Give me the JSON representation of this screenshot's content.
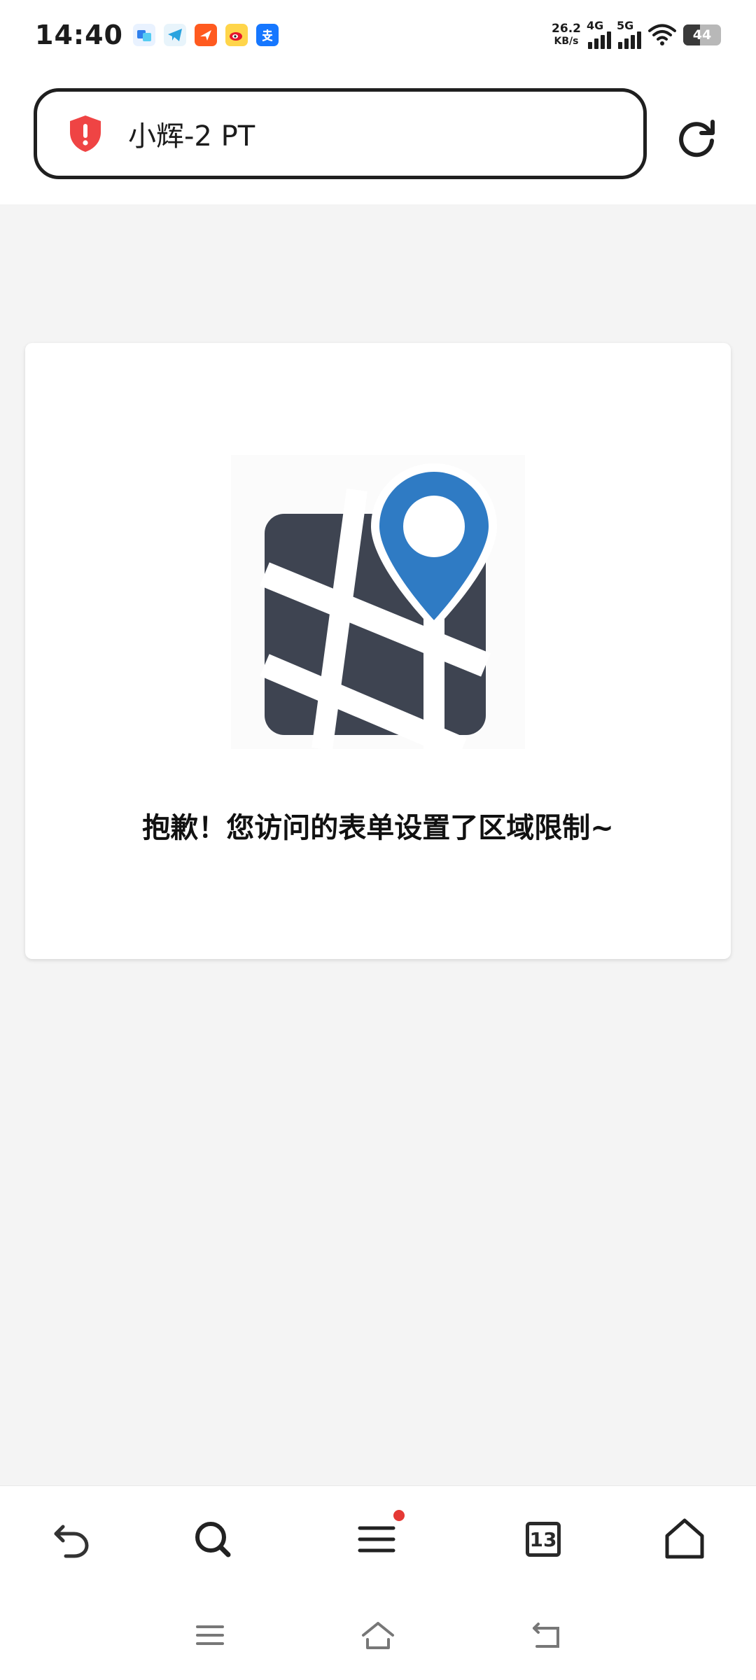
{
  "status_bar": {
    "time": "14:40",
    "net_speed_value": "26.2",
    "net_speed_unit": "KB/s",
    "signal1_label": "4G",
    "signal2_label": "5G",
    "battery_level": "44"
  },
  "header": {
    "page_title": "小辉-2 PT"
  },
  "card": {
    "message": "抱歉！您访问的表单设置了区域限制~"
  },
  "toolbar": {
    "tabs_count": "13"
  },
  "colors": {
    "accent_blue": "#2f7bc4",
    "map_dark": "#3e4451",
    "shield_red": "#ef4444",
    "notification_red": "#e53935"
  },
  "icons": [
    "shield-alert-icon",
    "refresh-icon",
    "map-pin-icon",
    "back-icon",
    "search-icon",
    "menu-icon",
    "tabs-icon",
    "home-icon",
    "nav-menu-icon",
    "nav-home-icon",
    "nav-back-icon"
  ]
}
